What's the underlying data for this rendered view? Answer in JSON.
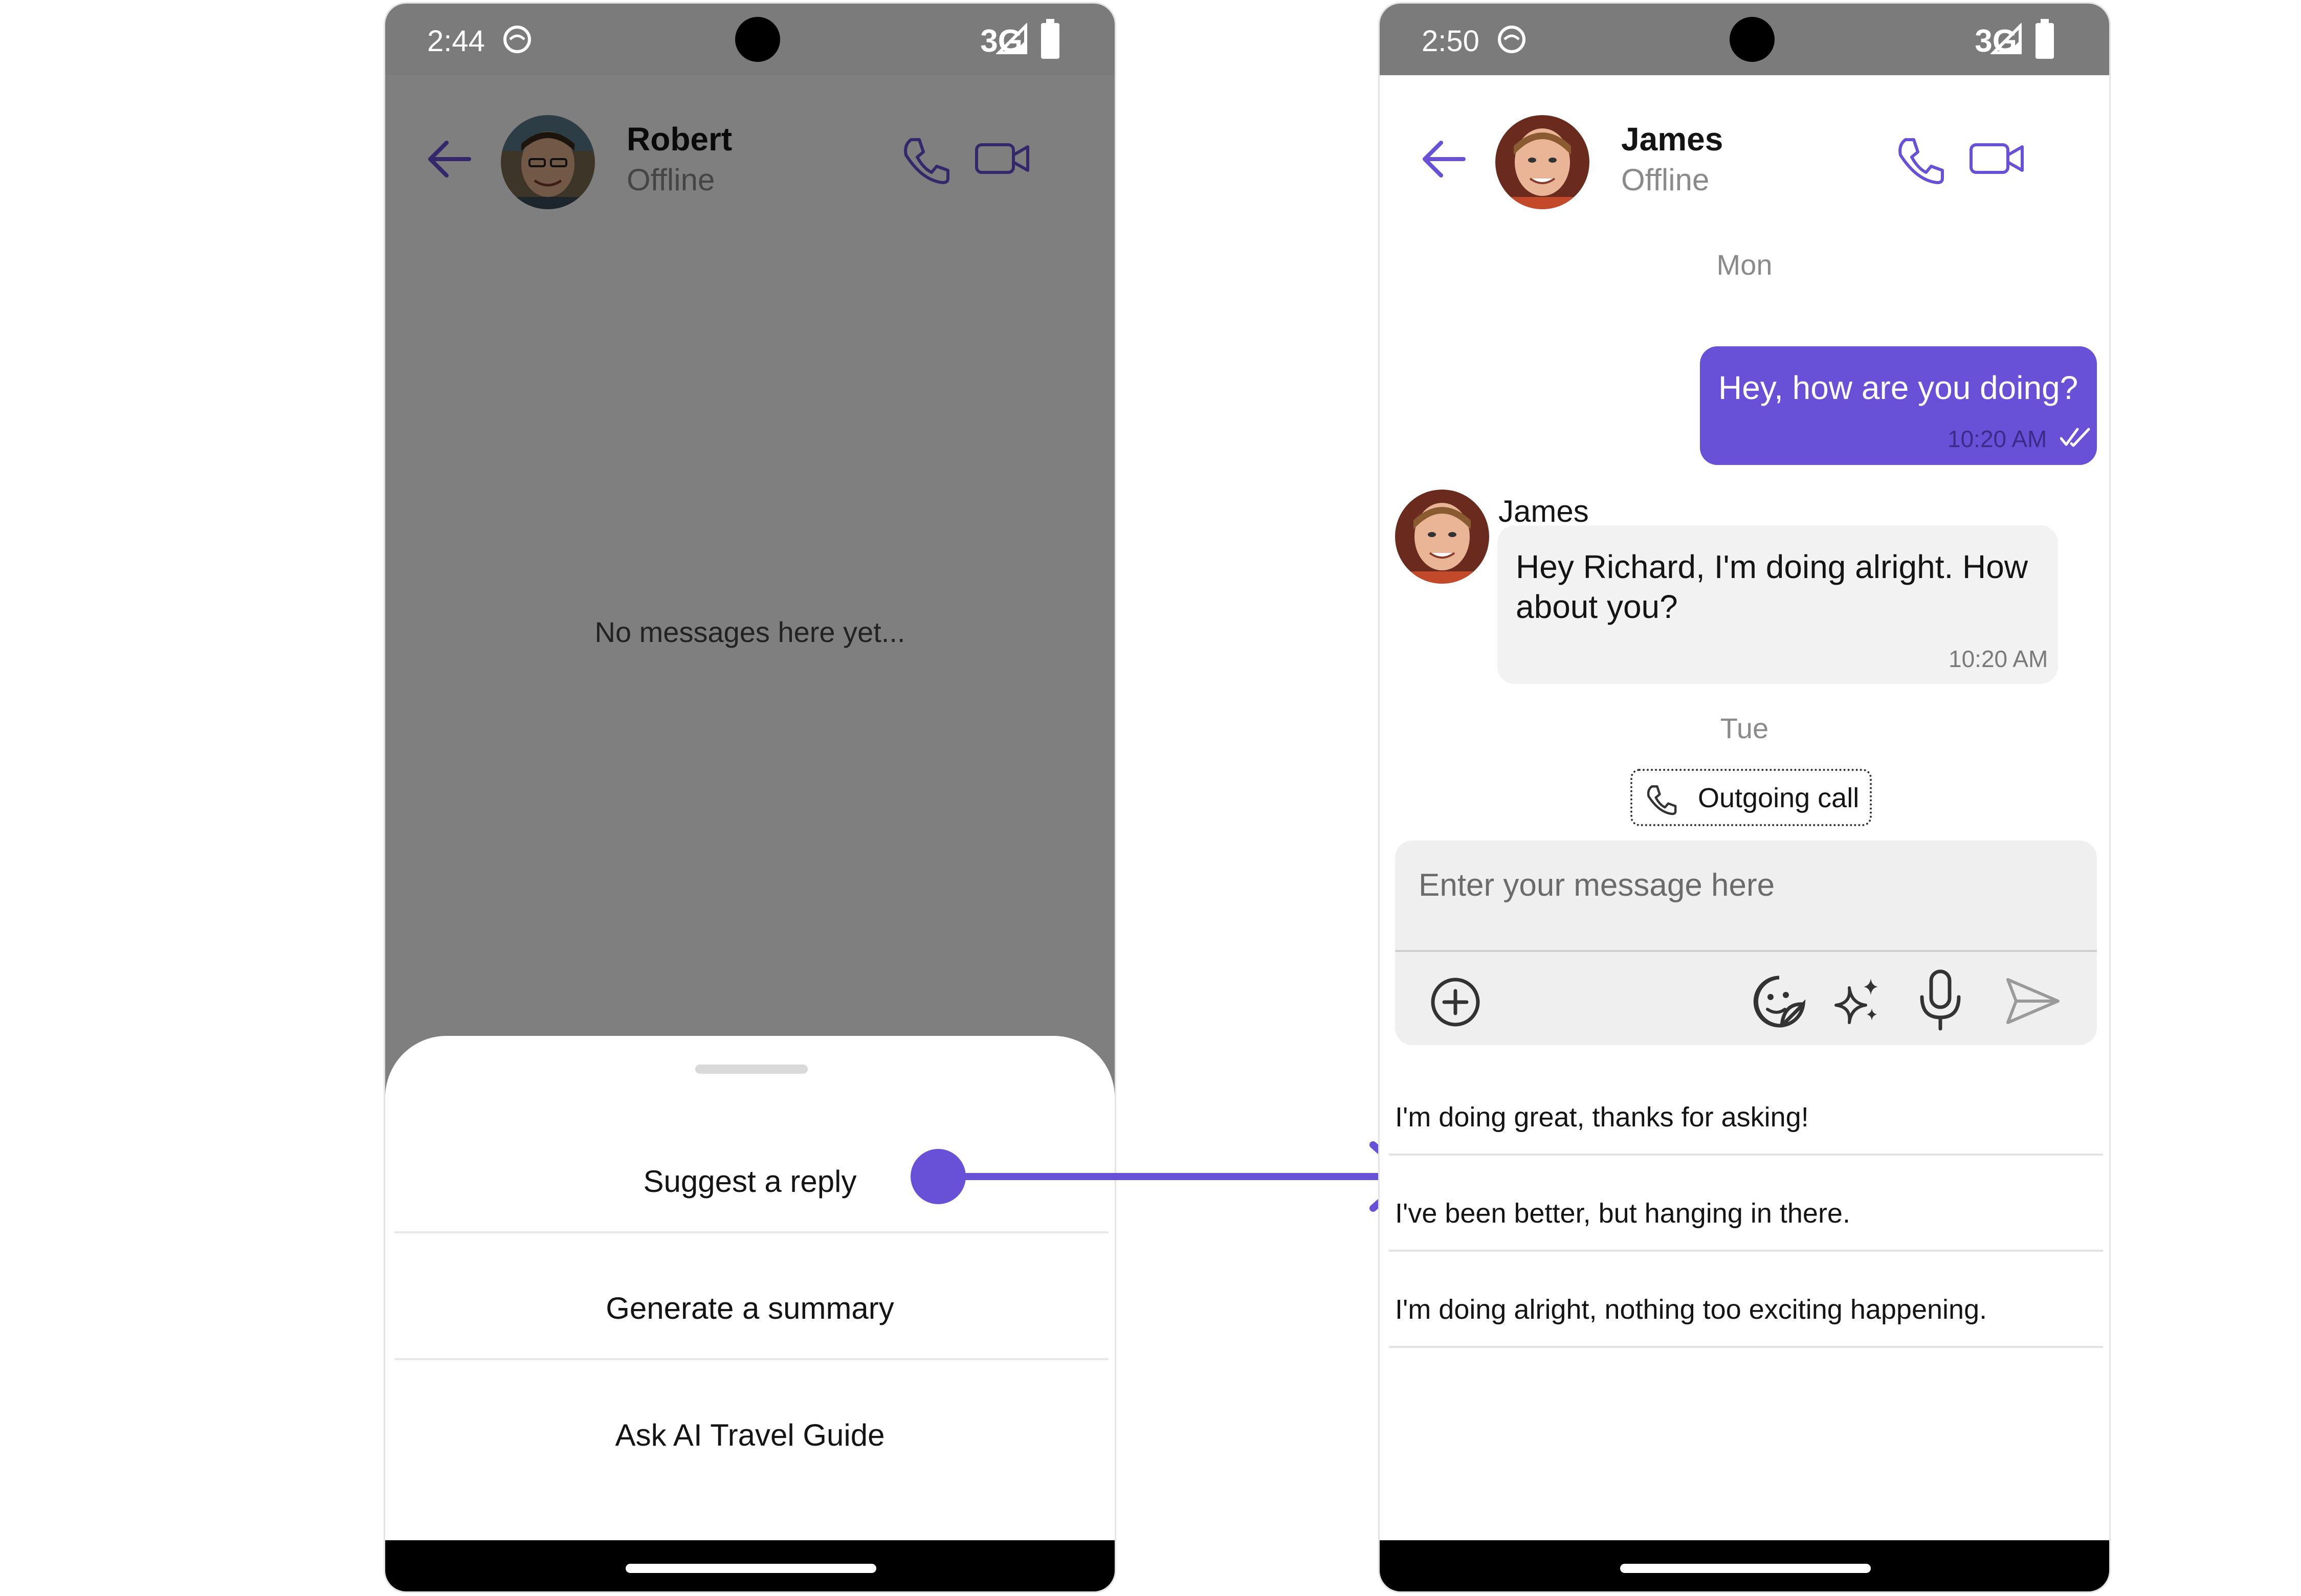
{
  "left_phone": {
    "status": {
      "time": "2:44",
      "network": "3G"
    },
    "header": {
      "name": "Robert",
      "status": "Offline"
    },
    "empty_state": "No messages here yet...",
    "sheet": {
      "items": [
        {
          "label": "Suggest a reply"
        },
        {
          "label": "Generate a summary"
        },
        {
          "label": "Ask AI Travel Guide"
        }
      ]
    }
  },
  "right_phone": {
    "status": {
      "time": "2:50",
      "network": "3G"
    },
    "header": {
      "name": "James",
      "status": "Offline"
    },
    "date_mon": "Mon",
    "outgoing_message": {
      "text": "Hey, how are you doing?",
      "time": "10:20 AM"
    },
    "incoming_message": {
      "sender": "James",
      "line1": "Hey Richard, I'm doing alright. How",
      "line2": "about you?",
      "time": "10:20 AM"
    },
    "date_tue": "Tue",
    "call_label": "Outgoing call",
    "composer": {
      "placeholder": "Enter your message here"
    },
    "suggestions": [
      "I'm doing great, thanks for asking!",
      "I've been better, but hanging in there.",
      "I'm doing alright, nothing too exciting happening."
    ]
  },
  "colors": {
    "accent": "#6851d6",
    "status_bar": "#7b7b7b",
    "bubble_incoming": "#f2f2f2",
    "muted_text": "#8a8a8a"
  },
  "icons": [
    "back-arrow-icon",
    "voice-call-icon",
    "video-call-icon",
    "status-app-icon",
    "signal-icon",
    "battery-icon",
    "read-receipt-icon",
    "outgoing-call-icon",
    "attach-plus-icon",
    "sticker-icon",
    "ai-sparkle-icon",
    "microphone-icon",
    "send-icon"
  ]
}
